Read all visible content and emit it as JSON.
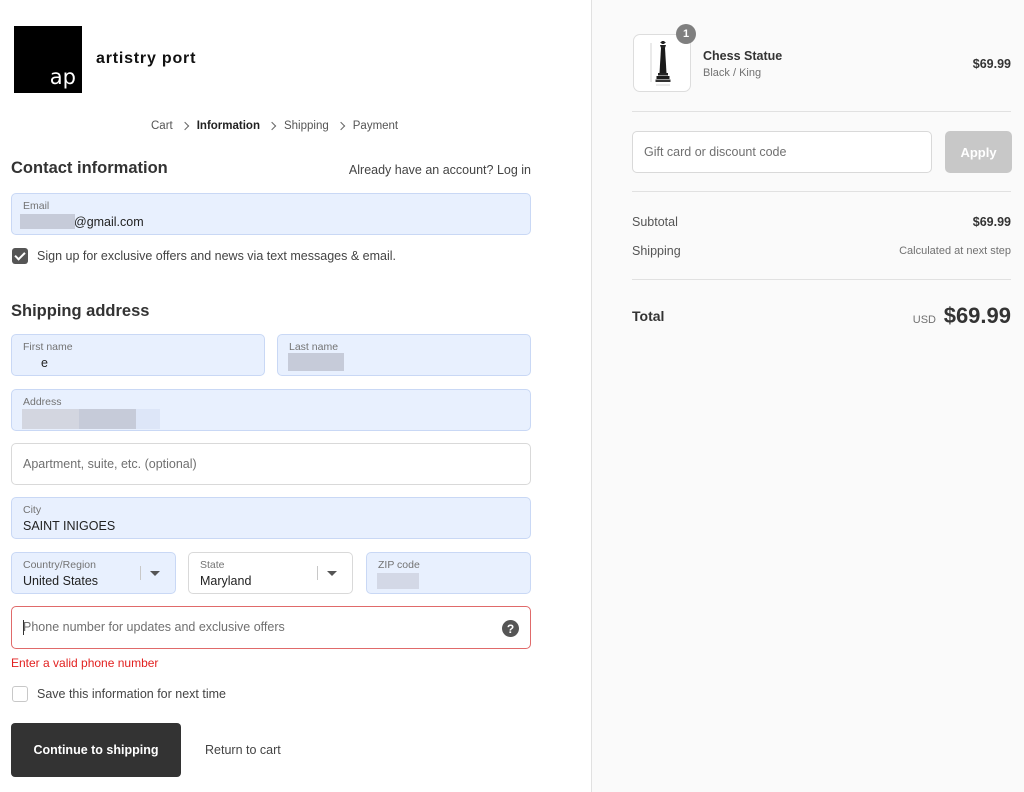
{
  "brand": {
    "logo_text": "ap",
    "name": "artistry port"
  },
  "breadcrumb": [
    "Cart",
    "Information",
    "Shipping",
    "Payment"
  ],
  "contact": {
    "title": "Contact information",
    "login_prompt": "Already have an account? Log in",
    "email_label": "Email",
    "email_value": "@gmail.com",
    "marketing_checkbox_label": "Sign up for exclusive offers and news via text messages & email.",
    "marketing_checked": true
  },
  "shipping": {
    "title": "Shipping address",
    "first_name_label": "First name",
    "first_name_value": "e",
    "last_name_label": "Last name",
    "address_label": "Address",
    "apartment_placeholder": "Apartment, suite, etc. (optional)",
    "city_label": "City",
    "city_value": "SAINT INIGOES",
    "country_label": "Country/Region",
    "country_value": "United States",
    "state_label": "State",
    "state_value": "Maryland",
    "zip_label": "ZIP code",
    "phone_placeholder": "Phone number for updates and exclusive offers",
    "phone_error": "Enter a valid phone number",
    "save_info_label": "Save this information for next time",
    "save_info_checked": false
  },
  "actions": {
    "continue_label": "Continue to shipping",
    "return_label": "Return to cart"
  },
  "order": {
    "quantity": "1",
    "product_name": "Chess Statue",
    "product_variant": "Black / King",
    "product_price": "$69.99",
    "discount_placeholder": "Gift card or discount code",
    "apply_label": "Apply",
    "subtotal_label": "Subtotal",
    "subtotal_value": "$69.99",
    "shipping_label": "Shipping",
    "shipping_value": "Calculated at next step",
    "total_label": "Total",
    "total_currency": "USD",
    "total_value": "$69.99"
  },
  "colors": {
    "accent_dark": "#333333",
    "autofill_bg": "#e8f0fe",
    "error_red": "#e22120",
    "apply_disabled": "#c8c8c8"
  },
  "icons": [
    "chevron-right-icon",
    "checkmark-icon",
    "caret-down-icon",
    "help-icon"
  ]
}
